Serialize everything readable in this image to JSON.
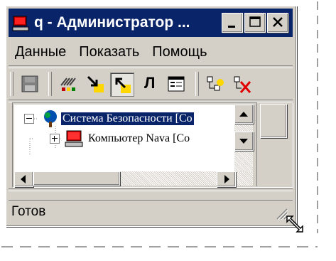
{
  "window": {
    "title": "q - Администратор ...",
    "buttons": {
      "minimize": "minimize",
      "maximize": "maximize",
      "close": "close"
    }
  },
  "menu": {
    "items": [
      "Данные",
      "Показать",
      "Помощь"
    ]
  },
  "toolbar": {
    "items": [
      {
        "name": "save-icon",
        "pressed": false
      },
      {
        "name": "hatch-grid-icon",
        "pressed": false
      },
      {
        "name": "arrow-down-right-icon",
        "pressed": false
      },
      {
        "name": "arrow-up-left-icon",
        "pressed": true
      },
      {
        "name": "lambda-icon",
        "pressed": false,
        "text": "Л"
      },
      {
        "name": "properties-icon",
        "pressed": false
      },
      {
        "name": "add-node-icon",
        "pressed": false
      },
      {
        "name": "delete-node-icon",
        "pressed": false
      }
    ]
  },
  "tree": {
    "nodes": [
      {
        "label": "Система Безопасности [Со",
        "expander": "minus",
        "icon": "tree-icon",
        "selected": true
      },
      {
        "label": "Компьютер Nava [Со",
        "expander": "plus",
        "icon": "computer-icon",
        "selected": false
      }
    ]
  },
  "status": {
    "text": "Готов"
  },
  "colors": {
    "title_bg": "#0a246a",
    "face": "#d4d0c8",
    "selection": "#0a246a"
  }
}
